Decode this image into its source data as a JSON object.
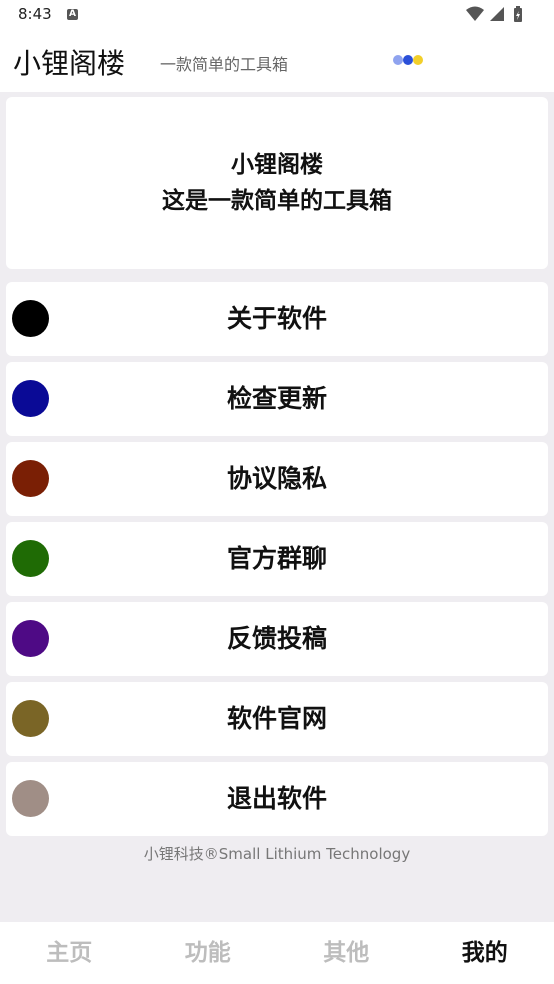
{
  "status_bar": {
    "time": "8:43",
    "notification_icon": "A"
  },
  "app_bar": {
    "title": "小锂阁楼",
    "subtitle": "一款简单的工具箱"
  },
  "header_card": {
    "line1": "小锂阁楼",
    "line2": "这是一款简单的工具箱"
  },
  "menu": [
    {
      "label": "关于软件",
      "color": "#000000"
    },
    {
      "label": "检查更新",
      "color": "#0a0a96"
    },
    {
      "label": "协议隐私",
      "color": "#7a1f05"
    },
    {
      "label": "官方群聊",
      "color": "#1f6b05"
    },
    {
      "label": "反馈投稿",
      "color": "#4e0a85"
    },
    {
      "label": "软件官网",
      "color": "#7a6526"
    },
    {
      "label": "退出软件",
      "color": "#a08e86"
    }
  ],
  "footer": "小锂科技®Small Lithium Technology",
  "bottom_nav": [
    {
      "label": "主页",
      "active": false
    },
    {
      "label": "功能",
      "active": false
    },
    {
      "label": "其他",
      "active": false
    },
    {
      "label": "我的",
      "active": true
    }
  ]
}
